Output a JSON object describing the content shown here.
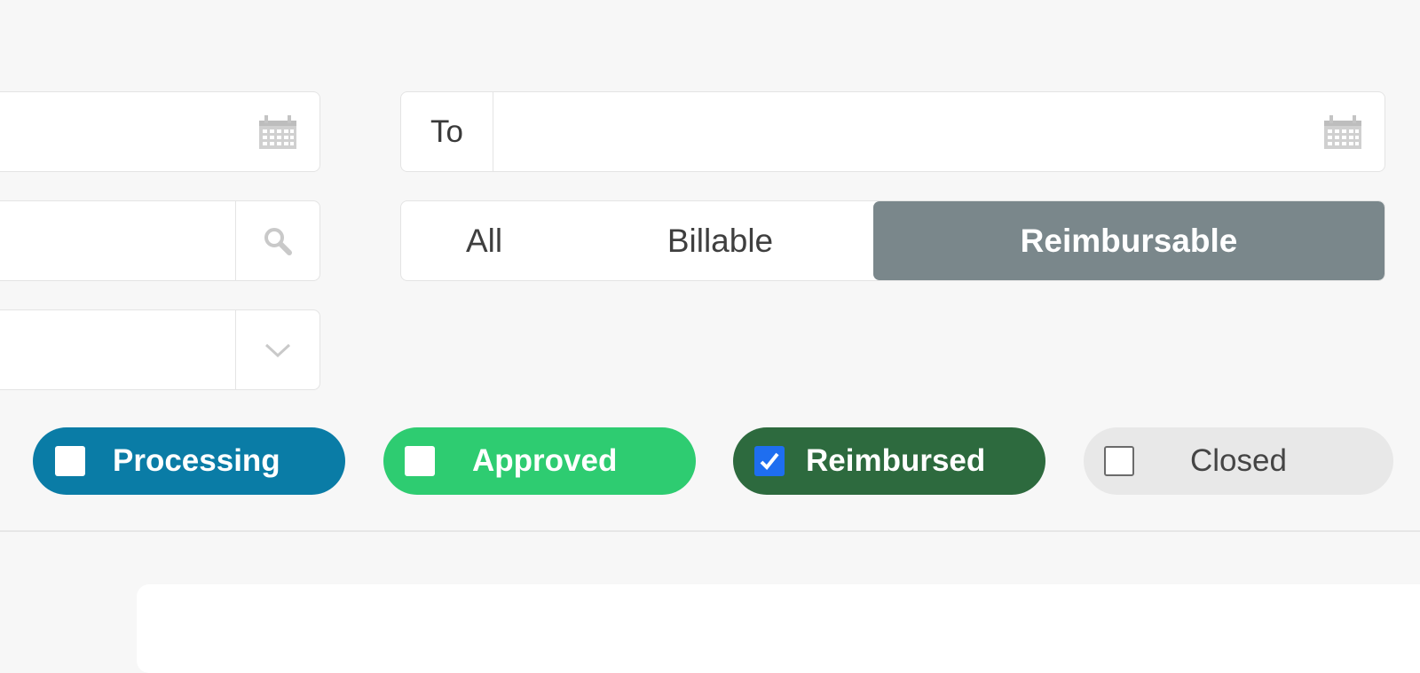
{
  "dates": {
    "to_label": "To",
    "icon": "calendar-icon"
  },
  "search": {
    "icon": "search-icon"
  },
  "dropdown": {
    "icon": "chevron-down-icon"
  },
  "expense_type": {
    "options": [
      "All",
      "Billable",
      "Reimbursable"
    ],
    "selected": "Reimbursable"
  },
  "status_filters": [
    {
      "label": "Processing",
      "checked": false,
      "color": "#0a7ca6"
    },
    {
      "label": "Approved",
      "checked": false,
      "color": "#2ecc71"
    },
    {
      "label": "Reimbursed",
      "checked": true,
      "color": "#2d6a3e"
    },
    {
      "label": "Closed",
      "checked": false,
      "color": "#e8e8e8"
    }
  ],
  "colors": {
    "segment_active": "#7a878b",
    "checkbox_checked": "#1e6ef0"
  }
}
